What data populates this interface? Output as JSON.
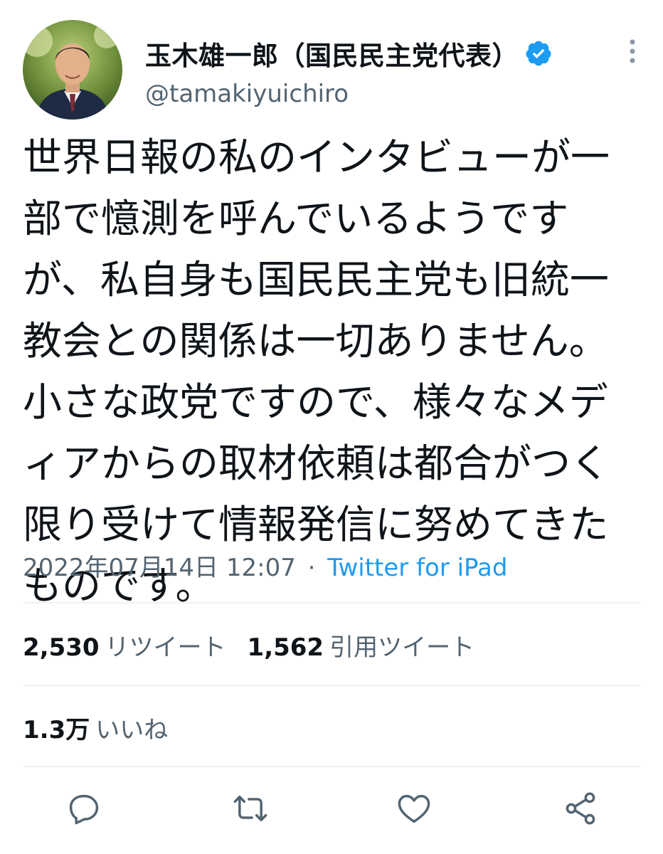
{
  "header": {
    "display_name": "玉木雄一郎（国民民主党代表）",
    "handle": "@tamakiyuichiro",
    "verified": true
  },
  "tweet": {
    "text": "世界日報の私のインタビューが一部で憶測を呼んでいるようですが、私自身も国民民主党も旧統一教会との関係は一切ありません。小さな政党ですので、様々なメディアからの取材依頼は都合がつく限り受けて情報発信に努めてきたものです。",
    "timestamp": "2022年07月14日 12:07",
    "separator": "·",
    "source": "Twitter for iPad"
  },
  "stats": {
    "retweets_count": "2,530",
    "retweets_label": "リツイート",
    "quotes_count": "1,562",
    "quotes_label": "引用ツイート",
    "likes_count": "1.3万",
    "likes_label": "いいね"
  },
  "icons": {
    "verified": "verified-badge-icon",
    "more": "more-vertical-icon",
    "reply": "reply-icon",
    "retweet": "retweet-icon",
    "like": "heart-icon",
    "share": "share-icon"
  },
  "colors": {
    "text": "#0f1419",
    "secondary": "#536471",
    "accent": "#1d9bf0",
    "divider": "#eff3f4"
  }
}
